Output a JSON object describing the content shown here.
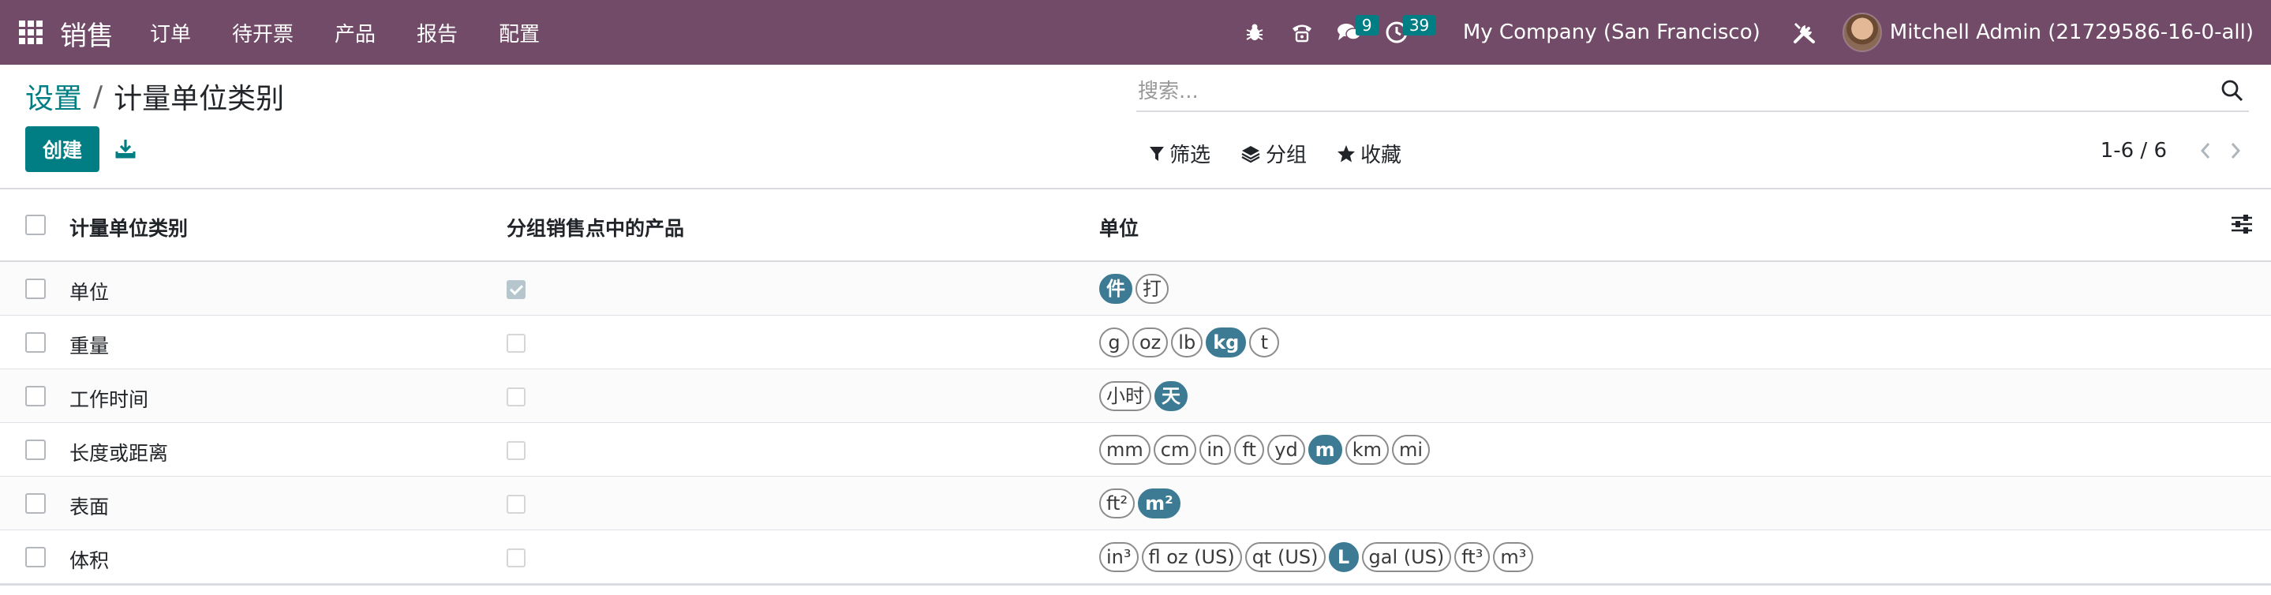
{
  "navbar": {
    "brand": "销售",
    "menu": [
      "订单",
      "待开票",
      "产品",
      "报告",
      "配置"
    ],
    "messages_count": "9",
    "activities_count": "39",
    "company": "My Company (San Francisco)",
    "user": "Mitchell Admin (21729586-16-0-all)"
  },
  "breadcrumb": {
    "parent": "设置",
    "separator": "/",
    "current": "计量单位类别"
  },
  "toolbar": {
    "create_label": "创建"
  },
  "search": {
    "placeholder": "搜索..."
  },
  "filters": {
    "filter_label": "筛选",
    "group_label": "分组",
    "favorites_label": "收藏"
  },
  "pager": {
    "value": "1-6 / 6"
  },
  "table": {
    "headers": {
      "name": "计量单位类别",
      "pos": "分组销售点中的产品",
      "units": "单位"
    },
    "rows": [
      {
        "name": "单位",
        "pos_grouped": true,
        "units": [
          {
            "label": "件",
            "reference": true
          },
          {
            "label": "打",
            "reference": false
          }
        ]
      },
      {
        "name": "重量",
        "pos_grouped": false,
        "units": [
          {
            "label": "g",
            "reference": false
          },
          {
            "label": "oz",
            "reference": false
          },
          {
            "label": "lb",
            "reference": false
          },
          {
            "label": "kg",
            "reference": true
          },
          {
            "label": "t",
            "reference": false
          }
        ]
      },
      {
        "name": "工作时间",
        "pos_grouped": false,
        "units": [
          {
            "label": "小时",
            "reference": false
          },
          {
            "label": "天",
            "reference": true
          }
        ]
      },
      {
        "name": "长度或距离",
        "pos_grouped": false,
        "units": [
          {
            "label": "mm",
            "reference": false
          },
          {
            "label": "cm",
            "reference": false
          },
          {
            "label": "in",
            "reference": false
          },
          {
            "label": "ft",
            "reference": false
          },
          {
            "label": "yd",
            "reference": false
          },
          {
            "label": "m",
            "reference": true
          },
          {
            "label": "km",
            "reference": false
          },
          {
            "label": "mi",
            "reference": false
          }
        ]
      },
      {
        "name": "表面",
        "pos_grouped": false,
        "units": [
          {
            "label": "ft²",
            "reference": false
          },
          {
            "label": "m²",
            "reference": true
          }
        ]
      },
      {
        "name": "体积",
        "pos_grouped": false,
        "units": [
          {
            "label": "in³",
            "reference": false
          },
          {
            "label": "fl oz (US)",
            "reference": false
          },
          {
            "label": "qt (US)",
            "reference": false
          },
          {
            "label": "L",
            "reference": true
          },
          {
            "label": "gal (US)",
            "reference": false
          },
          {
            "label": "ft³",
            "reference": false
          },
          {
            "label": "m³",
            "reference": false
          }
        ]
      }
    ]
  },
  "colors": {
    "navbar": "#714b67",
    "primary": "#017e84",
    "reference_tag": "#3c7b93"
  },
  "icons": {
    "apps": "grid-icon",
    "debug": "bug-icon",
    "voip": "phone-icon",
    "messages": "chat-icon",
    "activities": "clock-icon",
    "tools": "tools-icon",
    "download": "download-icon",
    "search": "search-icon",
    "filter": "funnel-icon",
    "group": "layers-icon",
    "favorites": "star-icon",
    "optional_columns": "sliders-icon"
  }
}
